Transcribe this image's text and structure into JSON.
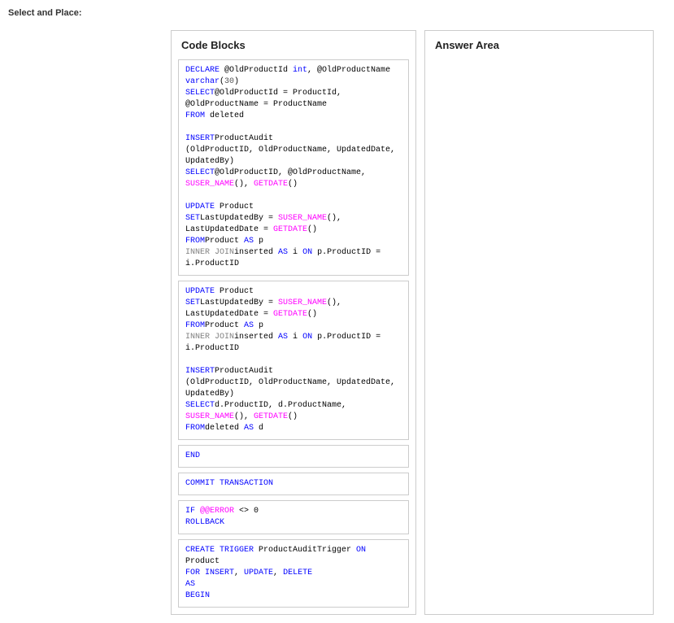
{
  "header": {
    "select_place": "Select and Place:"
  },
  "panels": {
    "code_blocks_title": "Code Blocks",
    "answer_area_title": "Answer Area"
  },
  "blocks": {
    "block6_end": "END",
    "block7_commit": "COMMIT TRANSACTION",
    "block8_if": "IF ",
    "block8_error": "@@ERROR",
    "block8_neq": " <> 0",
    "block8_rollback": "ROLLBACK"
  }
}
